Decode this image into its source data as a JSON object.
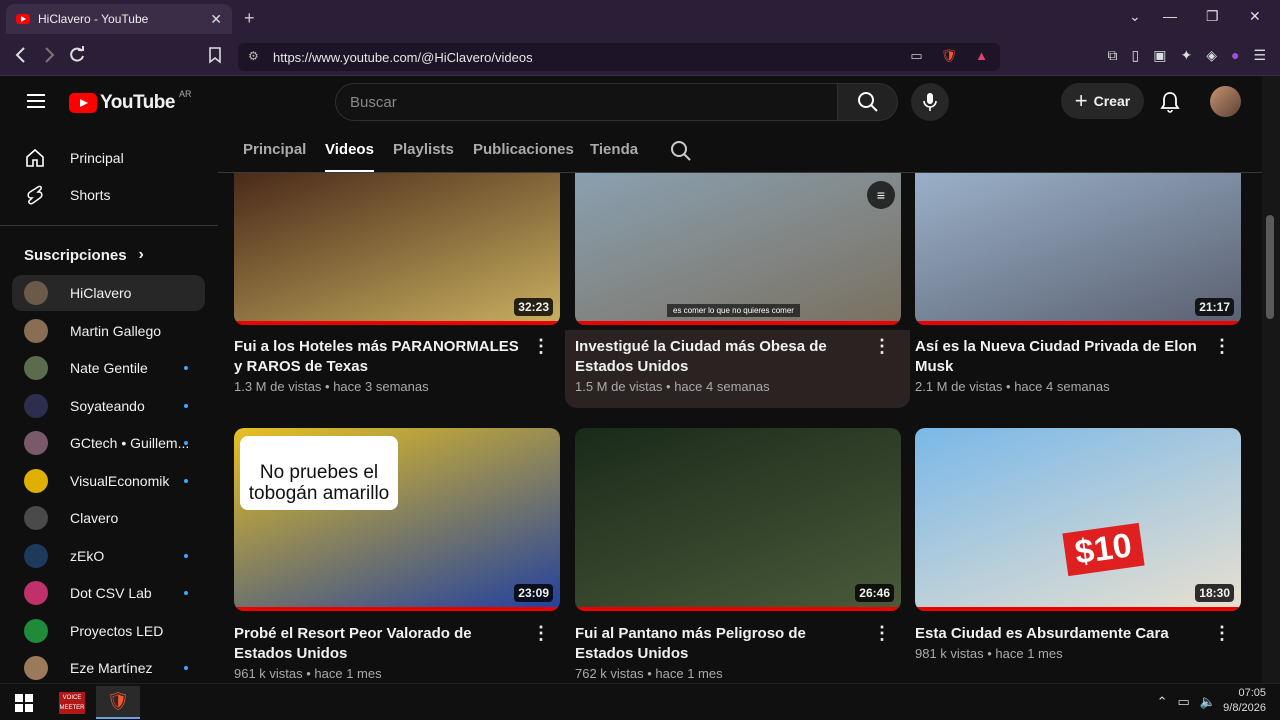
{
  "browser": {
    "tab_title": "HiClavero - YouTube",
    "tab_close": "✕",
    "new_tab": "+",
    "url": "https://www.youtube.com/@HiClavero/videos",
    "win_min": "—",
    "win_max": "❐",
    "win_close": "✕",
    "win_menu": "⌄",
    "brave_badge": "10"
  },
  "yt": {
    "logo_text": "YouTube",
    "country": "AR",
    "search_placeholder": "Buscar",
    "create_label": "Crear"
  },
  "sidebar": {
    "nav": [
      {
        "label": "Principal"
      },
      {
        "label": "Shorts"
      }
    ],
    "subs_header": "Suscripciones",
    "subs": [
      {
        "label": "HiClavero",
        "color": "#6b5a4a",
        "dot": false,
        "active": true
      },
      {
        "label": "Martin Gallego",
        "color": "#8a6d55",
        "dot": false
      },
      {
        "label": "Nate Gentile",
        "color": "#5c6b4e",
        "dot": true
      },
      {
        "label": "Soyateando",
        "color": "#2d2d4d",
        "dot": true
      },
      {
        "label": "GCtech • Guillem...",
        "color": "#7a5a6a",
        "dot": true
      },
      {
        "label": "VisualEconomik",
        "color": "#e0b000",
        "dot": true
      },
      {
        "label": "Clavero",
        "color": "#4a4a4a",
        "dot": false
      },
      {
        "label": "zEkO",
        "color": "#1e3a5a",
        "dot": true
      },
      {
        "label": "Dot CSV Lab",
        "color": "#c0306a",
        "dot": true
      },
      {
        "label": "Proyectos LED",
        "color": "#1f8a3a",
        "dot": false
      },
      {
        "label": "Eze Martínez",
        "color": "#9a7a5a",
        "dot": true
      }
    ]
  },
  "channel_tabs": [
    "Principal",
    "Videos",
    "Playlists",
    "Publicaciones",
    "Tienda"
  ],
  "videos": [
    {
      "title": "Fui a los Hoteles más PARANORMALES y RAROS de Texas",
      "meta": "1.3 M de vistas • hace 3 semanas",
      "duration": "32:23",
      "thumb_text": "",
      "colors": [
        "#4a2a1a",
        "#c9b060"
      ]
    },
    {
      "title": "Investigué la Ciudad más Obesa de Estados Unidos",
      "meta": "1.5 M de vistas • hace 4 semanas",
      "duration": "",
      "thumb_text": "es comer lo que no quieres comer",
      "colors": [
        "#8aa0b0",
        "#7a7060"
      ]
    },
    {
      "title": "Así es la Nueva Ciudad Privada de Elon Musk",
      "meta": "2.1 M de vistas • hace 4 semanas",
      "duration": "21:17",
      "thumb_text": "",
      "colors": [
        "#9ab0c8",
        "#5a6070"
      ]
    },
    {
      "title": "Probé el Resort Peor Valorado de Estados Unidos",
      "meta": "961 k vistas • hace 1 mes",
      "duration": "23:09",
      "thumb_text": "No pruebes el tobogán amarillo",
      "colors": [
        "#e8c020",
        "#2040a0"
      ]
    },
    {
      "title": "Fui al Pantano más Peligroso de Estados Unidos",
      "meta": "762 k vistas • hace 1 mes",
      "duration": "26:46",
      "thumb_text": "",
      "colors": [
        "#1a2a1a",
        "#4a5a3a"
      ]
    },
    {
      "title": "Esta Ciudad es Absurdamente Cara",
      "meta": "981 k vistas • hace 1 mes",
      "duration": "18:30",
      "thumb_text": "$10",
      "colors": [
        "#7ab8e8",
        "#e8e0d0"
      ]
    }
  ],
  "taskbar": {
    "time": "07:05",
    "date": "9/8/2026",
    "voicemeeter": "VOICE\nMEETER"
  }
}
